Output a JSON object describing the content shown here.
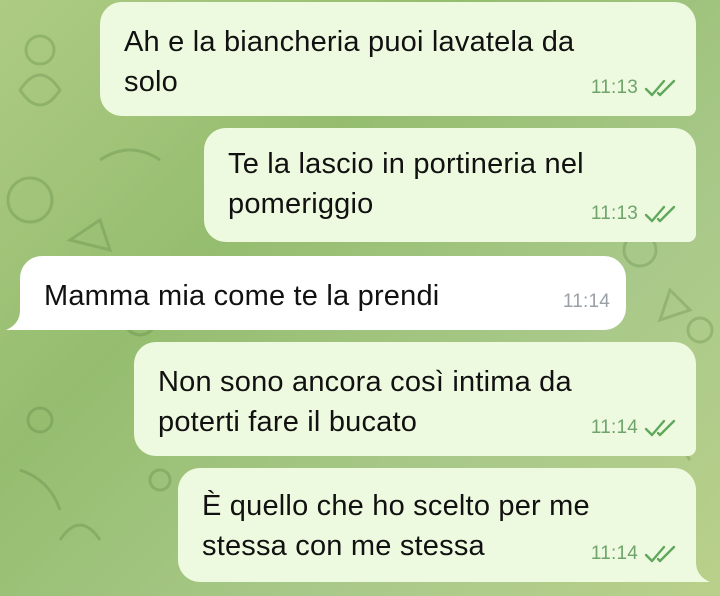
{
  "colors": {
    "outgoing_bubble": "#eefadf",
    "incoming_bubble": "#ffffff",
    "read_ticks": "#5fa85b",
    "wallpaper": "#a8c97f"
  },
  "messages": [
    {
      "direction": "outgoing",
      "text": "Ah e la biancheria puoi lavatela da\nsolo",
      "time": "11:13",
      "status": "read-double-check-icon"
    },
    {
      "direction": "outgoing",
      "text": "Te la lascio in portineria nel\npomeriggio",
      "time": "11:13",
      "status": "read-double-check-icon"
    },
    {
      "direction": "incoming",
      "text": "Mamma mia come te la prendi",
      "time": "11:14"
    },
    {
      "direction": "outgoing",
      "text": "Non sono ancora così intima da\npoterti fare il bucato",
      "time": "11:14",
      "status": "read-double-check-icon"
    },
    {
      "direction": "outgoing",
      "text": "È quello che ho scelto per me\nstessa con me stessa",
      "time": "11:14",
      "status": "read-double-check-icon"
    }
  ]
}
